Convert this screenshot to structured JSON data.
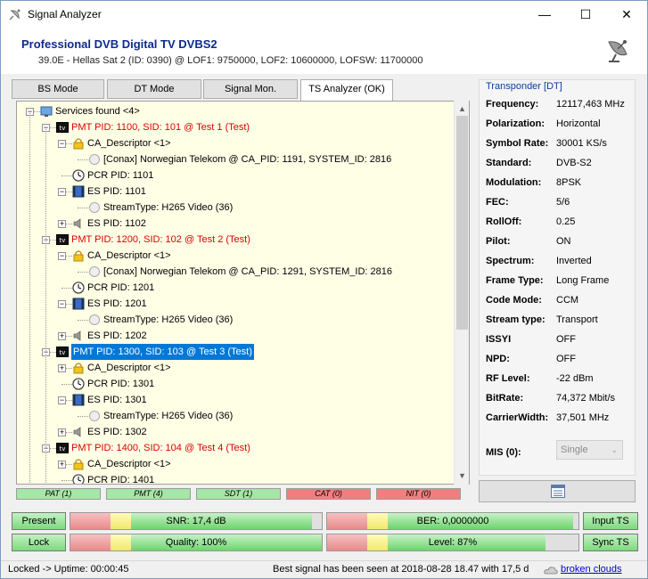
{
  "window": {
    "title": "Signal Analyzer",
    "minimize_icon": "minimize-icon",
    "maximize_icon": "maximize-icon",
    "close_icon": "close-icon"
  },
  "header": {
    "title": "Professional DVB Digital TV DVBS2",
    "subtitle": "39.0E - Hellas Sat 2 (ID: 0390) @ LOF1: 9750000, LOF2: 10600000, LOFSW: 11700000"
  },
  "tabs": [
    {
      "label": "BS Mode"
    },
    {
      "label": "DT Mode"
    },
    {
      "label": "Signal Mon."
    },
    {
      "label": "TS Analyzer (OK)"
    }
  ],
  "tree": {
    "rows": [
      {
        "text": "Services found <4>",
        "icon": "monitor-icon"
      },
      {
        "text": "PMT PID: 1100, SID: 101 @ Test 1 (Test)",
        "icon": "tv-icon"
      },
      {
        "text": "CA_Descriptor <1>",
        "icon": "lock-icon"
      },
      {
        "text": "[Conax] Norwegian Telekom @ CA_PID: 1191, SYSTEM_ID: 2816",
        "icon": "circle-icon"
      },
      {
        "text": "PCR PID: 1101",
        "icon": "clock-icon"
      },
      {
        "text": "ES PID: 1101",
        "icon": "film-icon"
      },
      {
        "text": "StreamType: H265 Video (36)",
        "icon": "circle-icon"
      },
      {
        "text": "ES PID: 1102",
        "icon": "speaker-icon"
      },
      {
        "text": "PMT PID: 1200, SID: 102 @ Test 2 (Test)",
        "icon": "tv-icon"
      },
      {
        "text": "CA_Descriptor <1>",
        "icon": "lock-icon"
      },
      {
        "text": "[Conax] Norwegian Telekom @ CA_PID: 1291, SYSTEM_ID: 2816",
        "icon": "circle-icon"
      },
      {
        "text": "PCR PID: 1201",
        "icon": "clock-icon"
      },
      {
        "text": "ES PID: 1201",
        "icon": "film-icon"
      },
      {
        "text": "StreamType: H265 Video (36)",
        "icon": "circle-icon"
      },
      {
        "text": "ES PID: 1202",
        "icon": "speaker-icon"
      },
      {
        "text": "PMT PID: 1300, SID: 103 @ Test 3 (Test)",
        "icon": "tv-icon"
      },
      {
        "text": "CA_Descriptor <1>",
        "icon": "lock-icon"
      },
      {
        "text": "PCR PID: 1301",
        "icon": "clock-icon"
      },
      {
        "text": "ES PID: 1301",
        "icon": "film-icon"
      },
      {
        "text": "StreamType: H265 Video (36)",
        "icon": "circle-icon"
      },
      {
        "text": "ES PID: 1302",
        "icon": "speaker-icon"
      },
      {
        "text": "PMT PID: 1400, SID: 104 @ Test 4 (Test)",
        "icon": "tv-icon"
      },
      {
        "text": "CA_Descriptor <1>",
        "icon": "lock-icon"
      },
      {
        "text": "PCR PID: 1401",
        "icon": "clock-icon"
      }
    ]
  },
  "table_status": [
    {
      "label": "PAT (1)",
      "state": "ok"
    },
    {
      "label": "PMT (4)",
      "state": "ok"
    },
    {
      "label": "SDT (1)",
      "state": "ok"
    },
    {
      "label": "CAT (0)",
      "state": "missing"
    },
    {
      "label": "NIT (0)",
      "state": "missing"
    }
  ],
  "transponder": {
    "title": "Transponder [DT]",
    "fields": [
      {
        "label": "Frequency:",
        "value": "12117,463 MHz"
      },
      {
        "label": "Polarization:",
        "value": "Horizontal"
      },
      {
        "label": "Symbol Rate:",
        "value": "30001 KS/s"
      },
      {
        "label": "Standard:",
        "value": "DVB-S2"
      },
      {
        "label": "Modulation:",
        "value": "8PSK"
      },
      {
        "label": "FEC:",
        "value": "5/6"
      },
      {
        "label": "RollOff:",
        "value": "0.25"
      },
      {
        "label": "Pilot:",
        "value": "ON"
      },
      {
        "label": "Spectrum:",
        "value": "Inverted"
      },
      {
        "label": "Frame Type:",
        "value": "Long Frame"
      },
      {
        "label": "Code Mode:",
        "value": "CCM"
      },
      {
        "label": "Stream type:",
        "value": "Transport"
      },
      {
        "label": "ISSYI",
        "value": "OFF"
      },
      {
        "label": "NPD:",
        "value": "OFF"
      },
      {
        "label": "RF Level:",
        "value": "-22 dBm"
      },
      {
        "label": "BitRate:",
        "value": "74,372 Mbit/s"
      },
      {
        "label": "CarrierWidth:",
        "value": "37,501 MHz"
      }
    ],
    "mis_label": "MIS (0):",
    "mis_value": "Single"
  },
  "bottom": {
    "present_label": "Present",
    "lock_label": "Lock",
    "input_ts_label": "Input TS",
    "sync_ts_label": "Sync TS",
    "snr": {
      "text": "SNR: 17,4 dB",
      "fraction": 0.96
    },
    "ber": {
      "text": "BER: 0,0000000",
      "fraction": 0.98
    },
    "quality": {
      "text": "Quality: 100%",
      "fraction": 1.0
    },
    "level": {
      "text": "Level: 87%",
      "fraction": 0.87
    }
  },
  "statusbar": {
    "left": "Locked -> Uptime: 00:00:45",
    "right": "Best signal has been seen at 2018-08-28 18.47 with 17,5 d",
    "weather_icon": "cloud-icon",
    "weather_link": "broken clouds"
  }
}
